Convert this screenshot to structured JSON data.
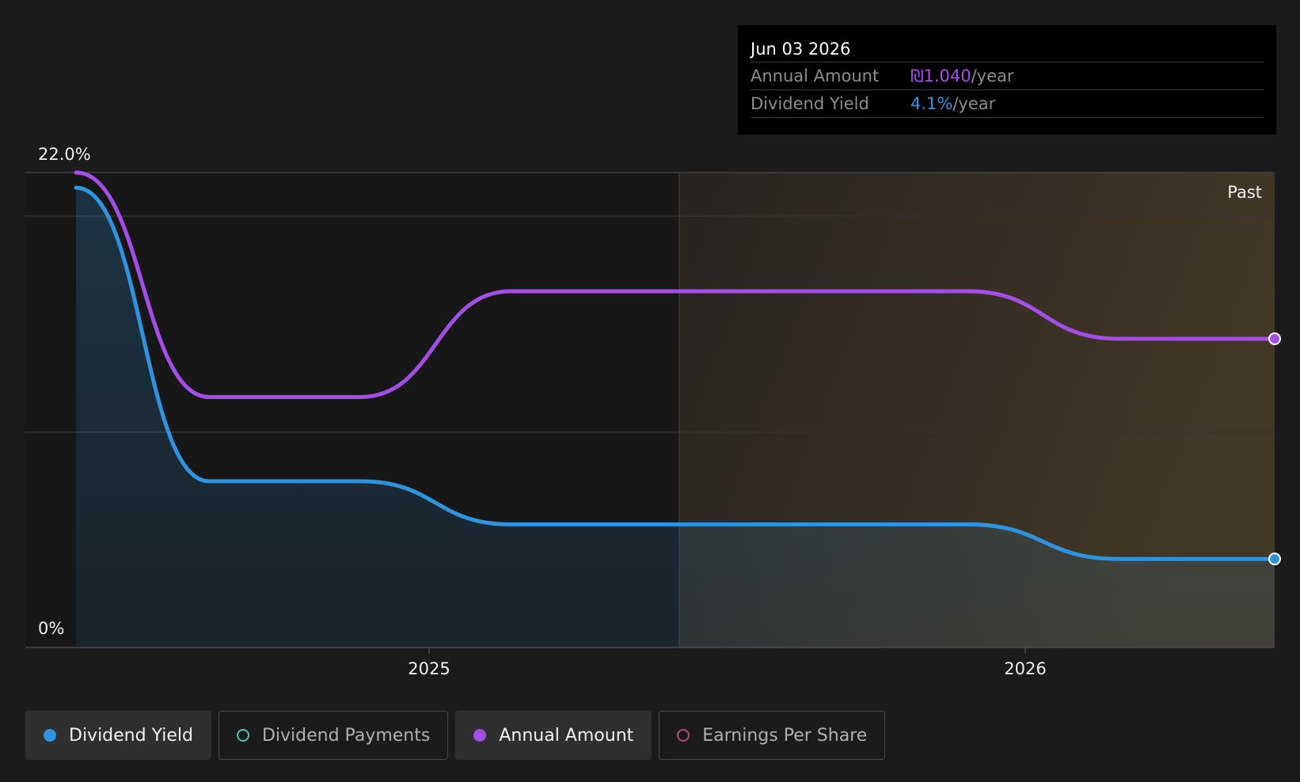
{
  "chart_data": {
    "type": "line",
    "y_axis": {
      "top_label": "22.0%",
      "bottom_label": "0%",
      "ylim": [
        0,
        22.0
      ]
    },
    "x_ticks": [
      "2025",
      "2026"
    ],
    "past_label": "Past",
    "grid": true,
    "series": [
      {
        "name": "Annual Amount",
        "color": "#a44ee8",
        "x": [
          "2024-06-13",
          "2024-09-01",
          "2024-12-01",
          "2025-03-01",
          "2025-06-01",
          "2025-09-01",
          "2025-12-01",
          "2026-03-01",
          "2026-06-03"
        ],
        "values": [
          22.0,
          11.6,
          11.6,
          16.5,
          16.5,
          16.5,
          16.5,
          14.3,
          14.3
        ]
      },
      {
        "name": "Dividend Yield",
        "color": "#2f94e0",
        "x": [
          "2024-06-13",
          "2024-09-01",
          "2024-12-01",
          "2025-03-01",
          "2025-06-01",
          "2025-09-01",
          "2025-12-01",
          "2026-03-01",
          "2026-06-03"
        ],
        "values": [
          21.3,
          7.7,
          7.7,
          5.7,
          5.7,
          5.7,
          5.7,
          4.1,
          4.1
        ]
      }
    ]
  },
  "tooltip": {
    "date": "Jun 03 2026",
    "rows": [
      {
        "label": "Annual Amount",
        "value": "₪1.040",
        "suffix": "/year",
        "color": "#a44ee8"
      },
      {
        "label": "Dividend Yield",
        "value": "4.1%",
        "suffix": "/year",
        "color": "#2f94e0"
      }
    ]
  },
  "legend": [
    {
      "label": "Dividend Yield",
      "color": "#2f94e0",
      "active": true
    },
    {
      "label": "Dividend Payments",
      "color": "#4fc3b2",
      "active": false
    },
    {
      "label": "Annual Amount",
      "color": "#a44ee8",
      "active": true
    },
    {
      "label": "Earnings Per Share",
      "color": "#b44a84",
      "active": false
    }
  ]
}
